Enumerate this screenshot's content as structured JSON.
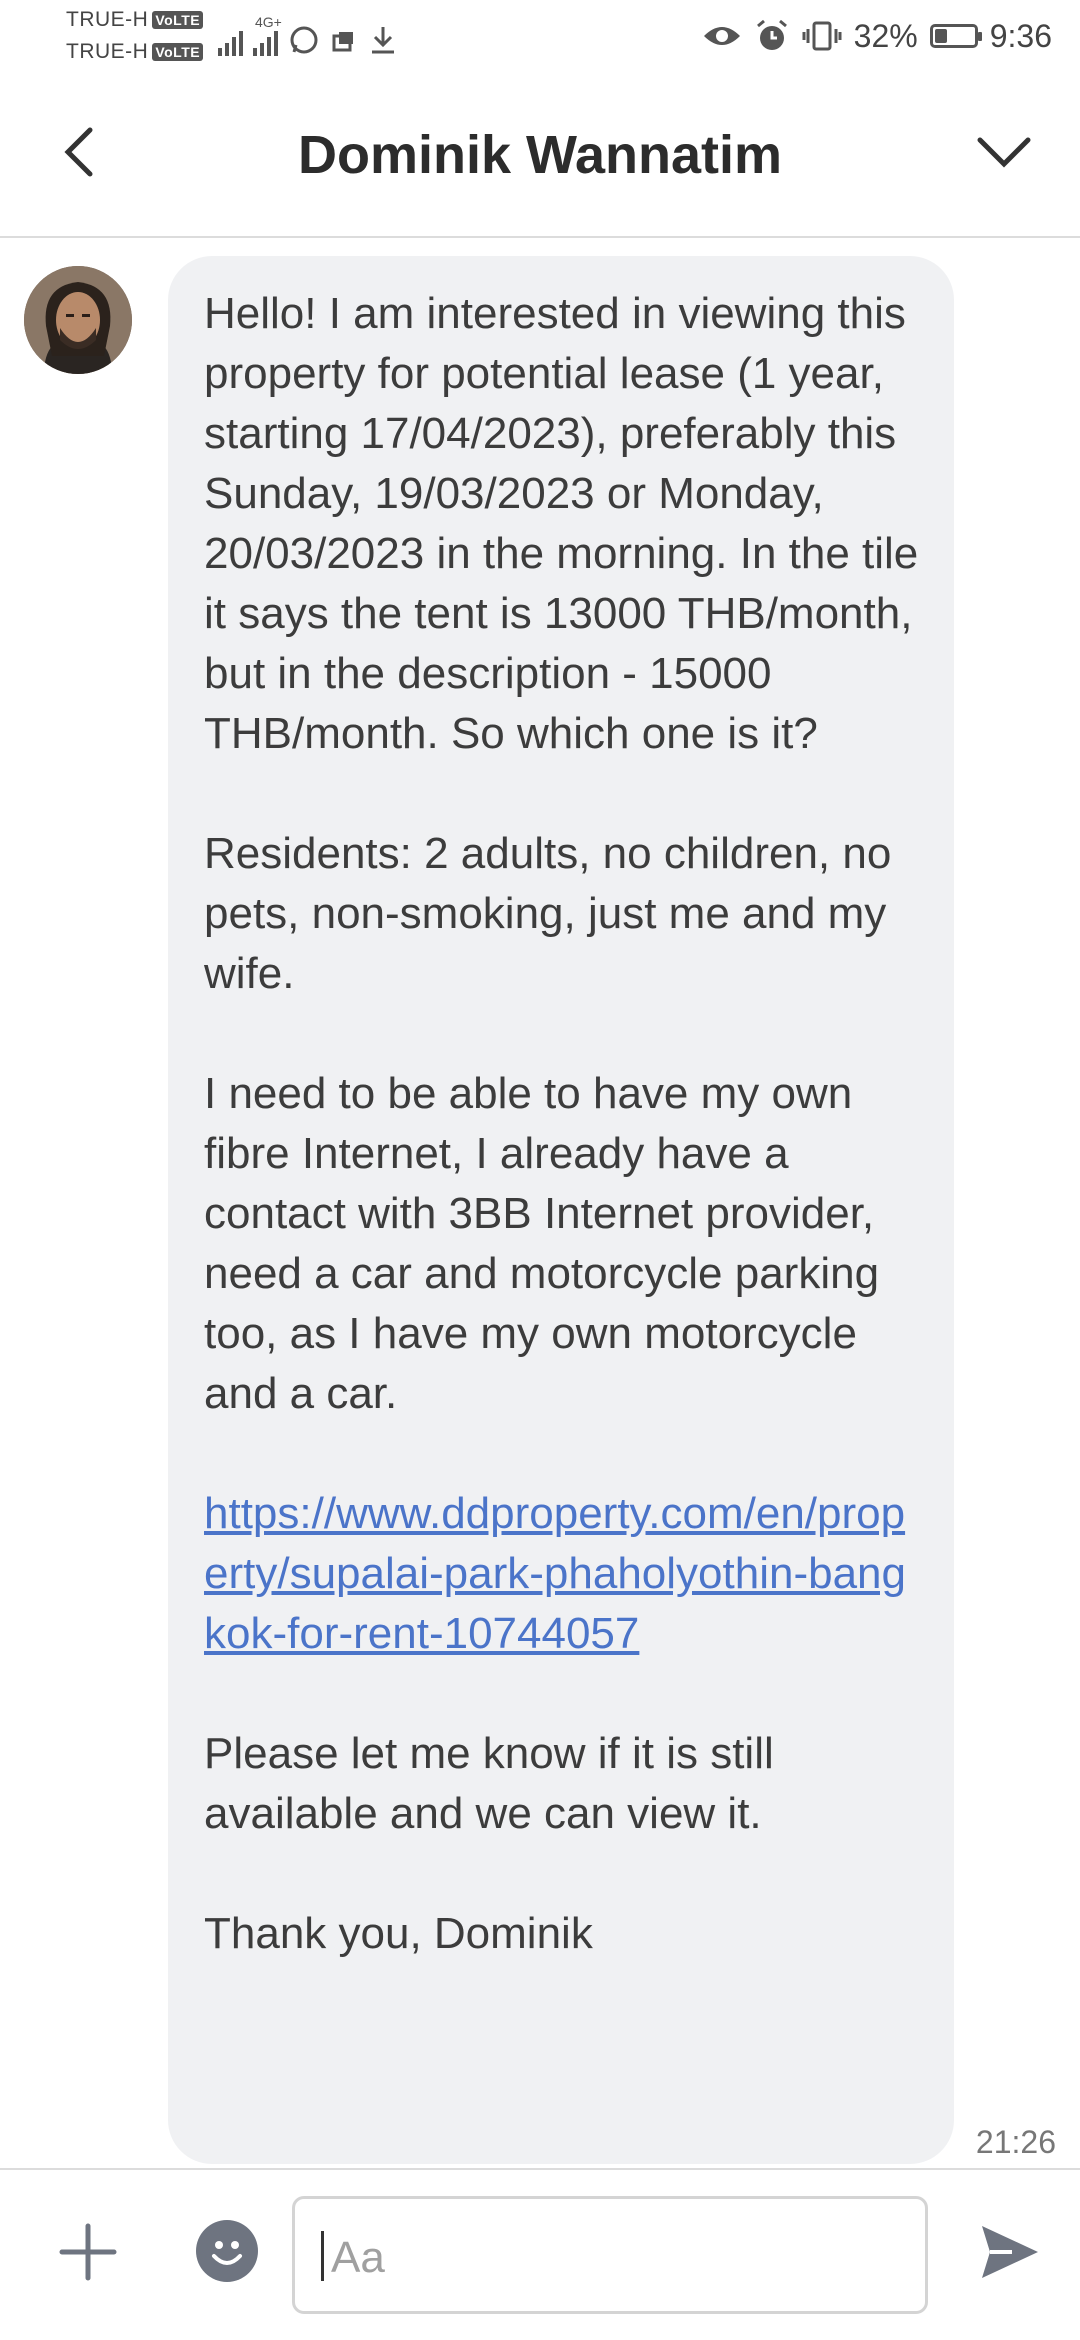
{
  "status_bar": {
    "carrier1": "TRUE-H",
    "carrier2": "TRUE-H",
    "volte": "VoLTE",
    "network": "4G+",
    "battery": "32%",
    "battery_level": 0.32,
    "time": "9:36",
    "icons": [
      "signal-icon",
      "whatsapp-icon",
      "data-saver-icon",
      "download-icon",
      "eye-icon",
      "alarm-icon",
      "vibrate-icon",
      "battery-icon"
    ]
  },
  "header": {
    "title": "Dominik Wannatim",
    "back_icon": "chevron-left-icon",
    "menu_icon": "chevron-down-icon"
  },
  "message": {
    "p1": "Hello! I am interested in viewing this property for potential lease (1 year, starting 17/04/2023), preferably this Sunday, 19/03/2023 or Monday, 20/03/2023 in the morning. In the tile it says the tent is 13000 THB/month, but in the description - 15000 THB/month. So which one is it?",
    "p2": "Residents: 2 adults, no children, no pets, non-smoking, just me and my wife.",
    "p3": "I need to be able to have my own fibre Internet, I already have a contact with 3BB Internet provider, need a car and motorcycle parking too, as I have my own motorcycle and a car.",
    "link": "https://www.ddproperty.com/en/property/supalai-park-phaholyothin-bangkok-for-rent-10744057",
    "p4": "Please let me know if it is still available and we can view it.",
    "p5": "Thank you, Dominik",
    "time": "21:26"
  },
  "input": {
    "placeholder": "Aa",
    "plus_icon": "plus-icon",
    "emoji_icon": "emoji-icon",
    "send_icon": "send-icon"
  },
  "colors": {
    "bubble": "#f0f1f3",
    "link": "#4b74c9",
    "icon_gray": "#6e7480"
  }
}
